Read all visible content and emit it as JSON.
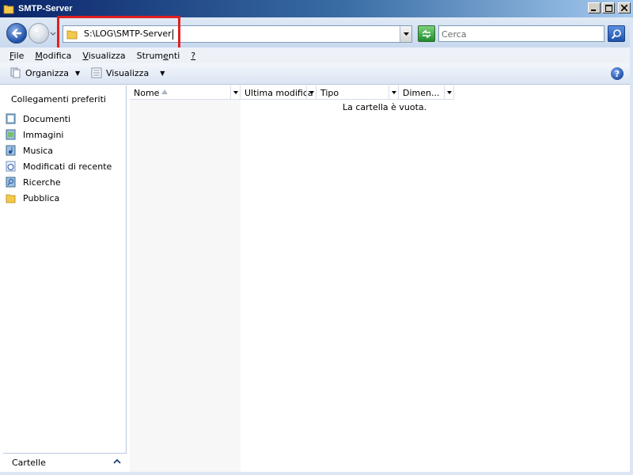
{
  "window": {
    "title": "SMTP-Server"
  },
  "address": {
    "path": "S:\\LOG\\SMTP-Server"
  },
  "search": {
    "placeholder": "Cerca"
  },
  "menu": [
    {
      "label": "File",
      "u": "F",
      "rest": "ile"
    },
    {
      "label": "Modifica",
      "u": "M",
      "rest": "odifica"
    },
    {
      "label": "Visualizza",
      "u": "V",
      "rest": "isualizza"
    },
    {
      "label": "Strumenti",
      "pre": "Strum",
      "u": "e",
      "rest": "nti"
    },
    {
      "label": "?",
      "u": "?",
      "rest": ""
    }
  ],
  "toolbar": {
    "organize_label": "Organizza",
    "view_label": "Visualizza"
  },
  "favorites": {
    "title": "Collegamenti preferiti",
    "items": [
      {
        "label": "Documenti",
        "icon": "documents-icon"
      },
      {
        "label": "Immagini",
        "icon": "pictures-icon"
      },
      {
        "label": "Musica",
        "icon": "music-icon"
      },
      {
        "label": "Modificati di recente",
        "icon": "recent-icon"
      },
      {
        "label": "Ricerche",
        "icon": "searches-icon"
      },
      {
        "label": "Pubblica",
        "icon": "public-folder-icon"
      }
    ]
  },
  "folders": {
    "label": "Cartelle"
  },
  "columns": [
    {
      "label": "Nome"
    },
    {
      "label": "Ultima modifica"
    },
    {
      "label": "Tipo"
    },
    {
      "label": "Dimen..."
    }
  ],
  "content": {
    "empty_message": "La cartella è vuota."
  }
}
